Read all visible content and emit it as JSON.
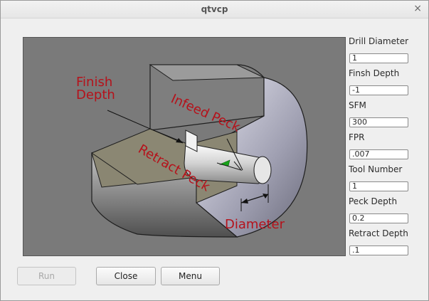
{
  "window": {
    "title": "qtvcp",
    "close_glyph": "×"
  },
  "diagram": {
    "labels": {
      "finish_depth_line1": "Finish",
      "finish_depth_line2": "Depth",
      "infeed_peck": "Infeed Peck",
      "retract_peck": "Retract Peck",
      "diameter": "Diameter"
    },
    "label_color": "#b5121b"
  },
  "fields": [
    {
      "label": "Drill Diameter",
      "value": "1"
    },
    {
      "label": "Finsh Depth",
      "value": "-1"
    },
    {
      "label": "SFM",
      "value": "300"
    },
    {
      "label": "FPR",
      "value": ".007"
    },
    {
      "label": "Tool Number",
      "value": "1"
    },
    {
      "label": "Peck Depth",
      "value": "0.2"
    },
    {
      "label": "Retract Depth",
      "value": ".1"
    }
  ],
  "buttons": {
    "run": "Run",
    "close": "Close",
    "menu": "Menu"
  }
}
